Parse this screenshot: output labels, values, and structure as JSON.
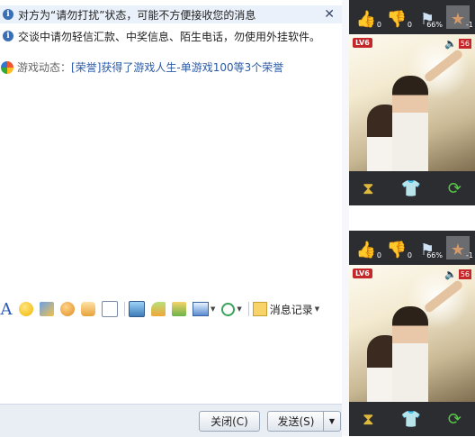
{
  "notices": {
    "dnd": "对方为“请勿打扰”状态，可能不方便接收您的消息",
    "warning": "交谈中请勿轻信汇款、中奖信息、陌生电话，勿使用外挂软件。"
  },
  "game": {
    "label": "游戏动态：",
    "link": "[荣誉]获得了游戏人生-单游戏100等3个荣誉"
  },
  "toolbar": {
    "font_icon": "A",
    "history_label": "消息记录"
  },
  "buttons": {
    "close": "关闭(C)",
    "send": "发送(S)"
  },
  "panels": [
    {
      "like_count": "0",
      "dislike_count": "0",
      "percent": "66%",
      "star_count": "-1",
      "level": "LV6",
      "volume": "56"
    },
    {
      "like_count": "0",
      "dislike_count": "0",
      "percent": "66%",
      "star_count": "-1",
      "level": "LV6",
      "volume": "56"
    }
  ]
}
